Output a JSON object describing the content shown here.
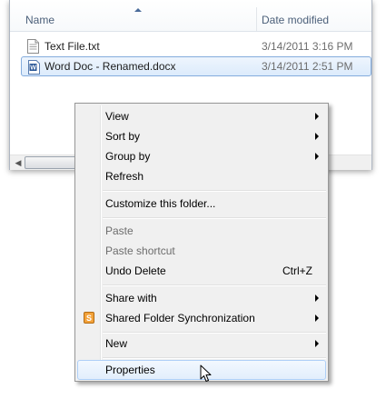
{
  "explorer": {
    "columns": {
      "name": "Name",
      "date_modified": "Date modified"
    },
    "files": [
      {
        "name": "Text File.txt",
        "date": "3/14/2011 3:16 PM",
        "icon": "text-file-icon"
      },
      {
        "name": "Word Doc - Renamed.docx",
        "date": "3/14/2011 2:51 PM",
        "icon": "word-document-icon",
        "selected": true
      }
    ],
    "scroll_left_glyph": "◀"
  },
  "context_menu": {
    "view": "View",
    "sort_by": "Sort by",
    "group_by": "Group by",
    "refresh": "Refresh",
    "customize": "Customize this folder...",
    "paste": "Paste",
    "paste_shortcut": "Paste shortcut",
    "undo_delete": "Undo Delete",
    "undo_delete_shortcut": "Ctrl+Z",
    "share_with": "Share with",
    "shared_folder_sync": "Shared Folder Synchronization",
    "shared_folder_sync_icon_letter": "S",
    "new": "New",
    "properties": "Properties"
  },
  "colors": {
    "selection_border": "#84acdd",
    "menu_background": "#f0f0f0",
    "menu_highlight_border": "#aecff7",
    "sync_icon": "#f3a23a"
  }
}
